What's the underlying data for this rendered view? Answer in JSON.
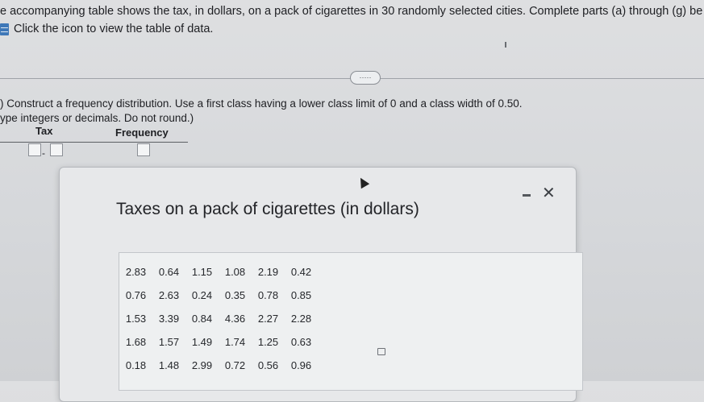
{
  "problem": {
    "intro": "e accompanying table shows the tax, in dollars, on a pack of cigarettes in 30 randomly selected cities. Complete parts (a) through (g) be",
    "view_table_link": "Click the icon to view the table of data.",
    "expand_label": "·····",
    "part_a_line1": ") Construct a frequency distribution. Use a first class having a lower class limit of 0 and a class width of 0.50.",
    "part_a_line2": "ype integers or decimals. Do not round.)"
  },
  "freq_table": {
    "col_tax": "Tax",
    "col_frequency": "Frequency",
    "dash": "-"
  },
  "popup": {
    "title": "Taxes on a pack of cigarettes (in dollars)",
    "minimize_label": "−",
    "close_label": "✕",
    "rows": [
      [
        "2.83",
        "0.64",
        "1.15",
        "1.08",
        "2.19",
        "0.42"
      ],
      [
        "0.76",
        "2.63",
        "0.24",
        "0.35",
        "0.78",
        "0.85"
      ],
      [
        "1.53",
        "3.39",
        "0.84",
        "4.36",
        "2.27",
        "2.28"
      ],
      [
        "1.68",
        "1.57",
        "1.49",
        "1.74",
        "1.25",
        "0.63"
      ],
      [
        "0.18",
        "1.48",
        "2.99",
        "0.72",
        "0.56",
        "0.96"
      ]
    ]
  },
  "icons": {
    "table_icon": "table-icon",
    "copy_icon": "copy-icon",
    "cursor": "cursor-icon"
  },
  "colors": {
    "link_icon": "#3f78b8",
    "background": "#d6d8db"
  }
}
